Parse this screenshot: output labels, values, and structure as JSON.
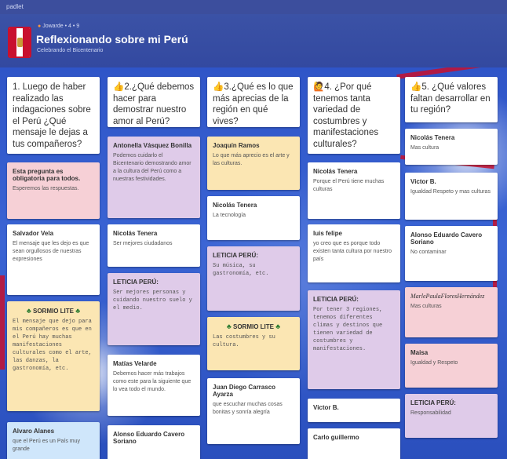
{
  "top_strip": "padlet",
  "header": {
    "meta": "Jowarde • 4 • 9",
    "title": "Reflexionando sobre mi Perú",
    "subtitle": "Celebrando el Bicentenario"
  },
  "columns": [
    {
      "question": "1. Luego de haber realizado las indagaciones sobre el Perú ¿Qué mensaje le dejas a tus compañeros?",
      "posts": [
        {
          "title": "Esta pregunta es obligatoria para todos.",
          "body": "Esperemos las respuestas.",
          "color": "#f6d0d6"
        },
        {
          "title": "Salvador Vela",
          "body": "El mensaje que les dejo es que sean orgullosos de nuestras expresiones",
          "color": "#ffffff"
        },
        {
          "title": "SORMIO LITE",
          "body": "El mensaje que dejo para mis compañeros es que en el Perú hay muchas manifestaciones culturales como el arte, las danzas, la gastronomía, etc.",
          "color": "#fbe6b3"
        },
        {
          "title": "Alvaro Alanes",
          "body": "que el Perú es un País muy grande",
          "color": "#cfe6fb"
        }
      ]
    },
    {
      "question": "2.¿Qué debemos hacer para demostrar nuestro amor al Perú?",
      "posts": [
        {
          "title": "Antonella Vásquez Bonilla",
          "body": "Podemos cuidarlo el Bicentenario demostrando amor a la cultura del Perú como a nuestras festividades.",
          "color": "#dfcbe9"
        },
        {
          "title": "Nicolás Tenera",
          "body": "Ser mejores ciudadanos",
          "color": "#ffffff"
        },
        {
          "title": "LETICIA PERÚ:",
          "body": "Ser mejores personas y cuidando nuestro suelo y el medio.",
          "color": "#dfcbe9"
        },
        {
          "title": "Matías Velarde",
          "body": "Debemos hacer más trabajos como este para la siguiente que lo vea todo el mundo.",
          "color": "#ffffff"
        },
        {
          "title": "Alonso Eduardo Cavero Soriano",
          "body": "",
          "color": "#ffffff"
        }
      ]
    },
    {
      "question": "3.¿Qué es lo que más aprecias de la región en qué vives?",
      "posts": [
        {
          "title": "Joaquín Ramos",
          "body": "Lo que más aprecio es el arte y las culturas.",
          "color": "#fbe6b3"
        },
        {
          "title": "Nicolás Tenera",
          "body": "La tecnología",
          "color": "#ffffff"
        },
        {
          "title": "LETICIA PERÚ:",
          "body": "Su música, su gastronomía, etc.",
          "color": "#dfcbe9"
        },
        {
          "title": "SORMIO LITE",
          "body": "Las costumbres y su cultura.",
          "color": "#fbe6b3"
        },
        {
          "title": "Juan Diego Carrasco Ayarza",
          "body": "que escuchar muchas cosas bonitas y sonría alegría",
          "color": "#ffffff"
        }
      ]
    },
    {
      "question": "4. ¿Por qué tenemos tanta variedad de costumbres y manifestaciones culturales?",
      "posts": [
        {
          "title": "Nicolás Tenera",
          "body": "Porque el Perú tiene muchas culturas",
          "color": "#ffffff"
        },
        {
          "title": "luis felipe",
          "body": "yo creo que es porque todo existen tanta cultura por nuestro país",
          "color": "#ffffff"
        },
        {
          "title": "LETICIA PERÚ:",
          "body": "Por tener 3 regiones, tenemos diferentes climas y destinos que tienen variedad de costumbres y manifestaciones.",
          "color": "#dfcbe9"
        },
        {
          "title": "Victor B.",
          "body": "",
          "color": "#ffffff"
        },
        {
          "title": "Carlo guillermo",
          "body": "",
          "color": "#ffffff"
        }
      ]
    },
    {
      "question": "5. ¿Qué valores faltan desarrollar en tu región?",
      "posts": [
        {
          "title": "Nicolás Tenera",
          "body": "Mas cultura",
          "color": "#ffffff"
        },
        {
          "title": "Victor B.",
          "body": "Igualdad Respeto y mas culturas",
          "color": "#ffffff"
        },
        {
          "title": "Alonso Eduardo Cavero Soriano",
          "body": "No contaminar",
          "color": "#ffffff"
        },
        {
          "title": "MarlePaulaFloresHernández",
          "body": "Mas culturas",
          "color": "#f6d0d6"
        },
        {
          "title": "Maisa",
          "body": "Igualdad y Respeto",
          "color": "#f6d0d6"
        },
        {
          "title": "LETICIA PERÚ:",
          "body": "Responsabilidad",
          "color": "#dfcbe9"
        }
      ]
    }
  ]
}
